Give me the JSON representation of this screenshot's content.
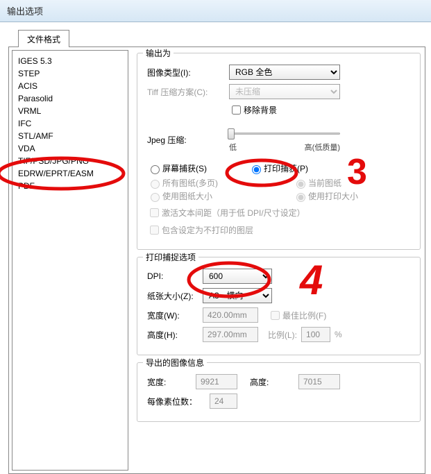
{
  "window": {
    "title": "输出选项"
  },
  "tab": {
    "label": "文件格式"
  },
  "formats": [
    "IGES 5.3",
    "STEP",
    "ACIS",
    "Parasolid",
    "VRML",
    "IFC",
    "STL/AMF",
    "VDA",
    "TIF/PSD/JPG/PNG",
    "EDRW/EPRT/EASM",
    "PDF"
  ],
  "outputAs": {
    "title": "输出为",
    "imageTypeLabel": "图像类型(I):",
    "imageTypeValue": "RGB 全色",
    "tiffCompLabel": "Tiff 压缩方案(C):",
    "tiffCompValue": "未压缩",
    "removeBgLabel": "移除背景",
    "jpegCompLabel": "Jpeg 压缩:",
    "sliderLow": "低",
    "sliderHigh": "高(低质量)",
    "screenCaptureLabel": "屏幕捕获(S)",
    "printCaptureLabel": "打印捕获(P)",
    "allSheetsLabel": "所有图纸(多页)",
    "currentSheetLabel": "当前图纸",
    "useSheetSizeLabel": "使用图纸大小",
    "usePrintSizeLabel": "使用打印大小",
    "activateSpacingLabel": "激活文本间距（用于低 DPI/尺寸设定）",
    "includeHiddenLabel": "包含设定为不打印的图层"
  },
  "printOpt": {
    "title": "打印捕捉选项",
    "dpiLabel": "DPI:",
    "dpiValue": "600",
    "paperLabel": "纸张大小(Z):",
    "paperValue": "A3 - 横向",
    "widthLabel": "宽度(W):",
    "widthValue": "420.00mm",
    "bestRatioLabel": "最佳比例(F)",
    "heightLabel": "高度(H):",
    "heightValue": "297.00mm",
    "ratioLabel": "比例(L):",
    "ratioValue": "100",
    "pct": "%"
  },
  "exportInfo": {
    "title": "导出的图像信息",
    "wLabel": "宽度:",
    "wValue": "9921",
    "hLabel": "高度:",
    "hValue": "7015",
    "bppLabel": "每像素位数：",
    "bppValue": "24"
  },
  "annot": {
    "n3": "3",
    "n4": "4"
  }
}
